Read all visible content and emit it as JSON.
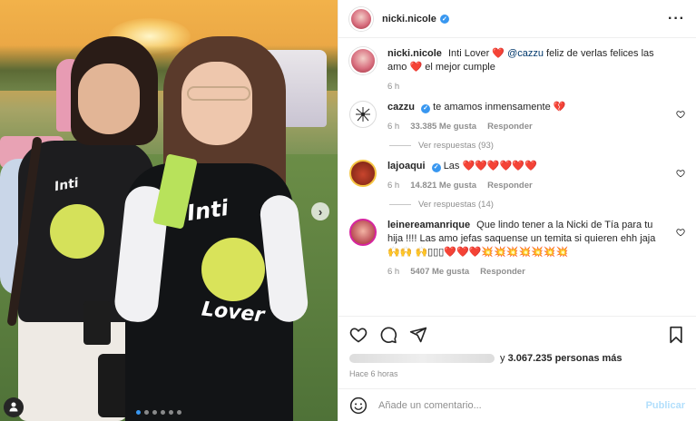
{
  "post": {
    "username": "nicki.nicole",
    "more_icon": "more-horizontal-icon"
  },
  "caption": {
    "username": "nicki.nicole",
    "text_part1": "Inti Lover",
    "heart1": "❤️",
    "mention": "@cazzu",
    "text_part2": "feliz de verlas felices las amo",
    "heart2": "❤️",
    "text_part3": "el mejor cumple",
    "time": "6 h"
  },
  "comments": [
    {
      "username": "cazzu",
      "text": "te amamos inmensamente",
      "emoji": "💔",
      "time": "6 h",
      "likes": "33.385 Me gusta",
      "reply": "Responder",
      "view_replies": "Ver respuestas (93)"
    },
    {
      "username": "lajoaqui",
      "text": "Las",
      "emoji": "❤️❤️❤️❤️❤️❤️",
      "time": "6 h",
      "likes": "14.821 Me gusta",
      "reply": "Responder",
      "view_replies": "Ver respuestas (14)"
    },
    {
      "username": "leinereamanrique",
      "text": "Que lindo tener a la Nicki de Tía para tu hija !!!! Las amo jefas saquense un temita si quieren ehh jaja",
      "emoji": "🙌🙌 🙌▯▯▯❤️❤️❤️💥💥💥💥💥💥💥",
      "time": "6 h",
      "likes": "5407 Me gusta",
      "reply": "Responder"
    }
  ],
  "likes_summary": {
    "text_prefix": "y",
    "count": "3.067.235",
    "text_suffix": "personas más"
  },
  "time_ago": "Hace 6 horas",
  "add_comment": {
    "placeholder": "Añade un comentario...",
    "publish": "Publicar"
  },
  "photo": {
    "shirt_left_text": "Inti",
    "shirt_right_text_top": "Inti",
    "shirt_right_text_bottom": "Lover",
    "carousel_dots": 6,
    "active_dot": 0
  },
  "colors": {
    "verified": "#3897f0",
    "link": "#00376b",
    "publish_disabled": "#b2dffc",
    "heart": "#e0245e"
  }
}
